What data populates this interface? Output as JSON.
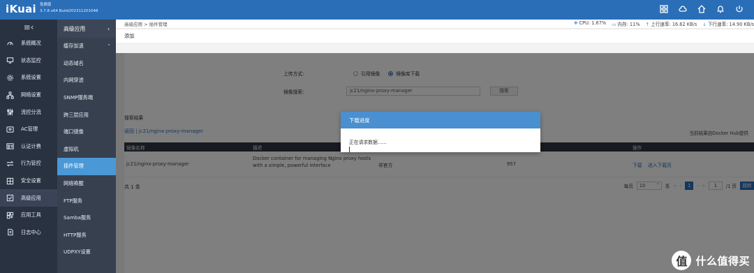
{
  "app": {
    "logo": "iKuai",
    "edition": "免费版",
    "build": "3.7.8 x64 Build202311201048"
  },
  "top_icons": [
    "grid-icon",
    "cloud-icon",
    "home-icon",
    "bell-icon",
    "power-icon"
  ],
  "sidebar": {
    "items": [
      {
        "label": "系统概况",
        "icon": "gauge-icon"
      },
      {
        "label": "状态监控",
        "icon": "monitor-icon"
      },
      {
        "label": "系统设置",
        "icon": "gear-icon"
      },
      {
        "label": "网络设置",
        "icon": "network-icon"
      },
      {
        "label": "流控分流",
        "icon": "sliders-icon"
      },
      {
        "label": "AC管理",
        "icon": "wifi-icon"
      },
      {
        "label": "认证计费",
        "icon": "id-card-icon"
      },
      {
        "label": "行为管控",
        "icon": "arrows-icon"
      },
      {
        "label": "安全设置",
        "icon": "shield-icon"
      },
      {
        "label": "高级应用",
        "icon": "app-icon"
      },
      {
        "label": "应用工具",
        "icon": "tools-icon"
      },
      {
        "label": "日志中心",
        "icon": "log-icon"
      }
    ]
  },
  "subnav": {
    "title": "高级应用",
    "items": [
      {
        "label": "缓存加速",
        "chevron": "˅"
      },
      {
        "label": "动态域名",
        "chevron": ""
      },
      {
        "label": "内网穿透",
        "chevron": ""
      },
      {
        "label": "SNMP服务端",
        "chevron": ""
      },
      {
        "label": "跨三层应用",
        "chevron": ""
      },
      {
        "label": "端口镜像",
        "chevron": ""
      },
      {
        "label": "虚拟机",
        "chevron": ""
      },
      {
        "label": "插件管理",
        "chevron": ""
      },
      {
        "label": "网络唤醒",
        "chevron": ""
      },
      {
        "label": "FTP服务",
        "chevron": ""
      },
      {
        "label": "Samba服务",
        "chevron": ""
      },
      {
        "label": "HTTP服务",
        "chevron": ""
      },
      {
        "label": "UDPXY设置",
        "chevron": ""
      }
    ]
  },
  "breadcrumb": "高级应用 > 插件管理",
  "stats": {
    "cpu": "CPU: 1.67%",
    "mem": "内存: 11%",
    "up": "上行速率: 16.62 KB/s",
    "down": "下行速率: 14.90 KB/s"
  },
  "add_label": "添加",
  "form": {
    "upload_label": "上传方式:",
    "opt_ref": "引用镜像",
    "opt_download": "镜像库下载",
    "search_label": "镜像搜索:",
    "search_value": "jc21/nginx-proxy-manager",
    "search_button": "搜索"
  },
  "results": {
    "label": "搜索结果",
    "back": "返回 | jc21/nginx-proxy-manager",
    "source_note": "当前结果由Docker Hub提供",
    "columns": [
      "镜像名称",
      "描述",
      "操作"
    ],
    "row": {
      "name": "jc21/nginx-proxy-manager",
      "desc1": "Docker container for managing Nginx proxy hosts",
      "desc2": "with a simple, powerful interface",
      "official": "非官方",
      "stars": "957",
      "action_download": "下载",
      "action_enter": "进入下载页"
    }
  },
  "footer": {
    "total": "共 1 条",
    "per_page_label": "每页",
    "per_page": "10",
    "unit": "条",
    "first": "«",
    "prev": "‹",
    "page": "1",
    "next": "›",
    "last": "»",
    "page_input": "1",
    "page_total": "/1 页",
    "go": "跳转"
  },
  "modal": {
    "title": "下载进度",
    "message": "正在请求数据......"
  },
  "watermark": {
    "glyph": "值",
    "text": "什么值得买"
  }
}
